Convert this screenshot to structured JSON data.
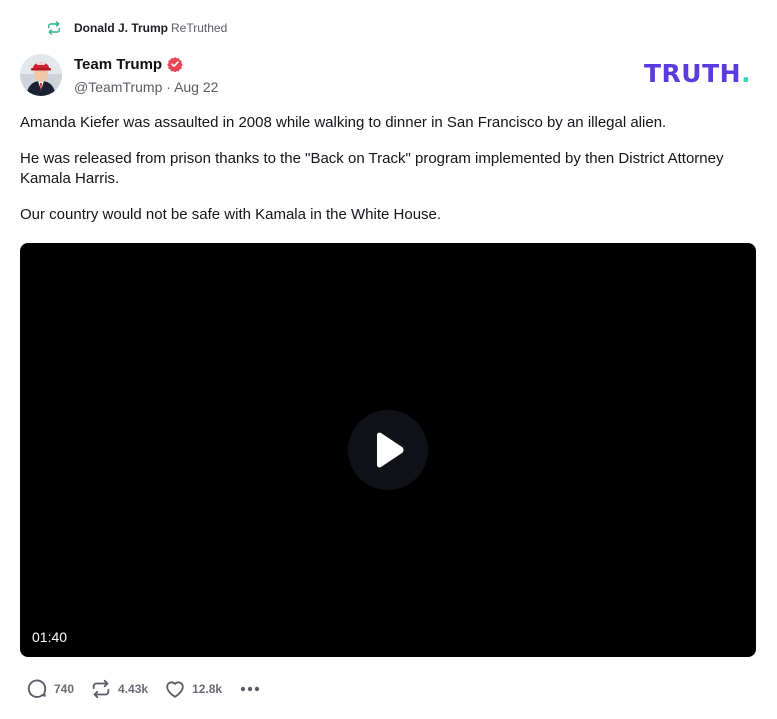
{
  "retruth": {
    "user": "Donald J. Trump",
    "label": "ReTruthed",
    "icon": "retruth-icon",
    "color": "#2fb38f"
  },
  "post": {
    "author_name": "Team Trump",
    "author_handle": "@TeamTrump",
    "separator": "·",
    "date": "Aug 22",
    "verified_icon": "verified-badge-icon",
    "verified_color": "#e8455a",
    "paragraphs": [
      "Amanda Kiefer was assaulted in 2008 while walking to dinner in San Francisco by an illegal alien.",
      "He was released from prison thanks to the \"Back on Track\" program implemented by then District Attorney Kamala Harris.",
      "Our country would not be safe with Kamala in the White House."
    ]
  },
  "brand": {
    "text": "TRUTH",
    "dot": ".",
    "color": "#5a3bdf",
    "dot_color": "#3ed3b4"
  },
  "video": {
    "duration": "01:40",
    "play_icon": "play-icon"
  },
  "actions": {
    "replies": {
      "icon": "comment-icon",
      "count": "740"
    },
    "retruths": {
      "icon": "retruth-icon",
      "count": "4.43k"
    },
    "likes": {
      "icon": "heart-icon",
      "count": "12.8k"
    },
    "more_icon": "more-options-icon"
  }
}
